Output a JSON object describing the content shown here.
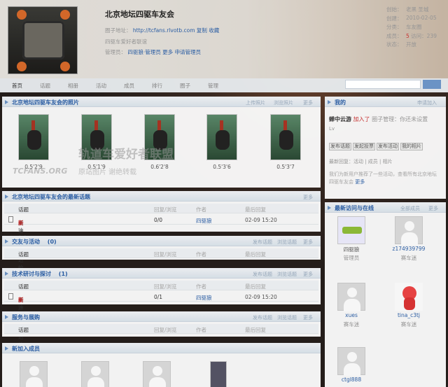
{
  "group": {
    "title": "北京地坛四驱车友会",
    "site_label": "圈子地址：",
    "site_url": "http://tcfans.rlvotb.com",
    "site_copy": "复制",
    "site_fav": "收藏",
    "desc": "四驱车爱好者联谊",
    "admin_label": "管理员：",
    "admins": "四驱狼·管理员",
    "more": "更多",
    "apply": "申请管理员"
  },
  "stats": [
    {
      "label": "创始：",
      "value": "老黑",
      "extra": "圣城"
    },
    {
      "label": "创建：",
      "value": "2010-02-05"
    },
    {
      "label": "分类：",
      "value": "车友圈"
    },
    {
      "label": "成员：",
      "value": "5",
      "extra": "访问：239"
    },
    {
      "label": "状态：",
      "value": "开放"
    }
  ],
  "nav": [
    "首页",
    "话题",
    "相册",
    "活动",
    "成员",
    "排行",
    "圈子",
    "管理"
  ],
  "photos": {
    "title": "北京地坛四驱车友会的照片",
    "actions": [
      "上传照片",
      "浏览照片",
      "更多"
    ],
    "captions": [
      "0.5'2'9",
      "0.5'1'9",
      "0.6'2'8",
      "0.5'3'6",
      "0.5'3'7"
    ]
  },
  "topics": {
    "title": "北京地坛四驱车友会的最新话题",
    "action": "更多",
    "headers": [
      "话题",
      "回复/浏览",
      "作者",
      "最后回复"
    ],
    "row": {
      "title": "奥迪0.6与马达的制作",
      "flag": "新",
      "views": "0/0",
      "author": "四驱狼",
      "time": "02-09 15:20"
    }
  },
  "sections": [
    {
      "title": "交友与活动",
      "count": "(0)",
      "actions": [
        "发布话题",
        "浏览话题",
        "更多"
      ]
    },
    {
      "title": "技术研讨与探讨",
      "count": "(1)",
      "actions": [
        "发布话题",
        "浏览话题",
        "更多"
      ],
      "row": {
        "title": "奥迪0.6与马达的制作",
        "flag": "新",
        "views": "0/1",
        "author": "四驱狼",
        "time": "02-09 15:20"
      }
    },
    {
      "title": "服务与展购",
      "count": "(0)",
      "actions": [
        "发布话题",
        "浏览话题",
        "更多"
      ]
    }
  ],
  "new_members": {
    "title": "新加入成员"
  },
  "me": {
    "title": "我的",
    "action": "申请加入",
    "name": "蝉中云游",
    "joined": "加入了",
    "desc": "圈子管理：你还未设置",
    "level": "Lv",
    "buttons": [
      "发布话题",
      "发起投票",
      "发布活动",
      "我的相片"
    ],
    "links": "最新回复：活动 | 成员 | 相片",
    "note": "我们为新用户推荐了一些活动，查看所有北京地坛四驱车友会",
    "more": "更多"
  },
  "visitors": {
    "title": "最新访问与在线",
    "actions": [
      "全部成员",
      "更多"
    ],
    "users": [
      {
        "name": "四驱狼",
        "sub": "管理员"
      },
      {
        "name": "z174939799",
        "sub": "赛车迷"
      },
      {
        "name": "xues",
        "sub": "赛车迷"
      },
      {
        "name": "tina_c3tj",
        "sub": "赛车迷"
      },
      {
        "name": "ctgl888",
        "sub": ""
      }
    ]
  },
  "watermark": {
    "site": "轨道车爱好者联盟",
    "brand": "TCFANS.ORG",
    "note": "原站图片 谢绝转载"
  },
  "colors": {
    "accent": "#2a5fa8",
    "header_bar": "#6b93c5"
  }
}
